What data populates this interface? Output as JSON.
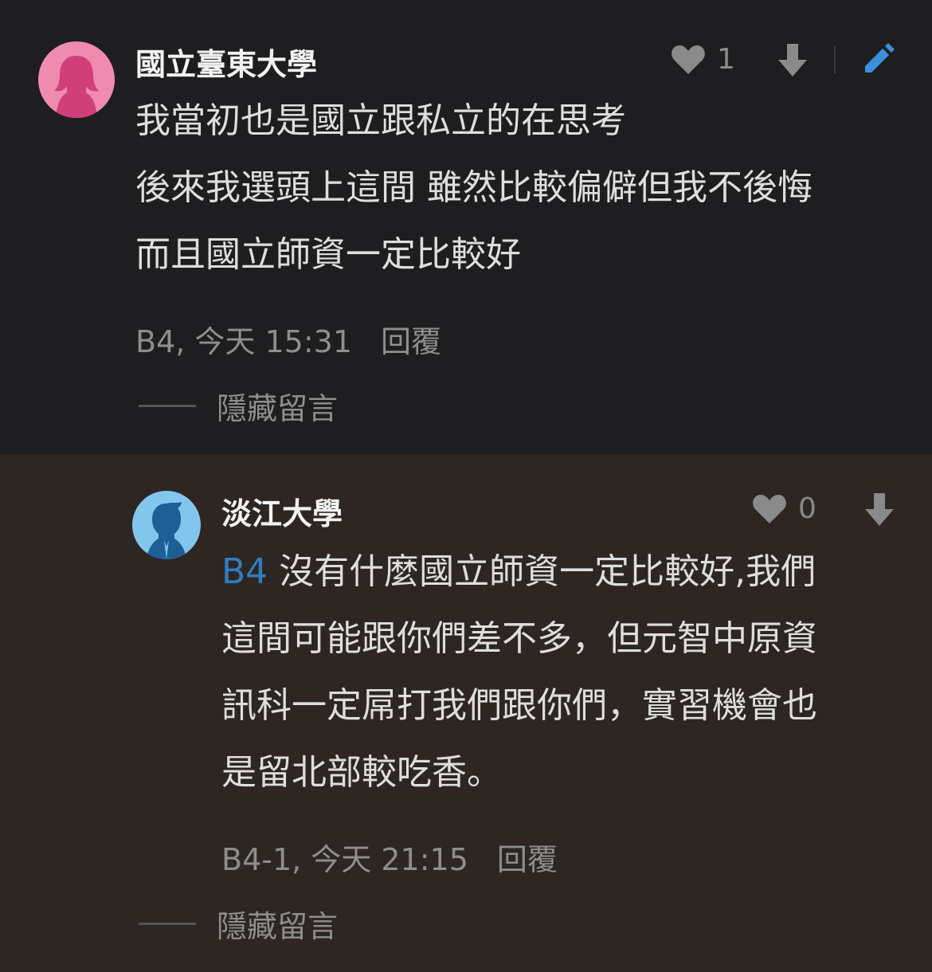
{
  "comments": [
    {
      "author": "國立臺東大學",
      "likes": "1",
      "lines": [
        "我當初也是國立跟私立的在思考",
        "後來我選頭上這間 雖然比較偏僻但我不後悔",
        "而且國立師資一定比較好"
      ],
      "meta": "B4, 今天 15:31",
      "reply_label": "回覆",
      "hide_label": "隱藏留言",
      "avatar_color": "#f07fa6",
      "icons": [
        "heart-icon",
        "thumbs-down-icon",
        "edit-pencil-icon"
      ]
    },
    {
      "author": "淡江大學",
      "likes": "0",
      "mention": "B4",
      "lines": [
        "沒有什麼國立師資一定比較好,我們",
        "這間可能跟你們差不多，但元智中原資",
        "訊科一定屌打我們跟你們，實習機會也",
        "是留北部較吃香。"
      ],
      "meta": "B4-1, 今天 21:15",
      "reply_label": "回覆",
      "hide_label": "隱藏留言",
      "avatar_color": "#7fc4ee",
      "icons": [
        "heart-icon",
        "thumbs-down-icon"
      ]
    }
  ],
  "colors": {
    "mention": "#2f7dc0",
    "edit_icon": "#3d8fdb",
    "reply_bg": "#2d2622"
  }
}
